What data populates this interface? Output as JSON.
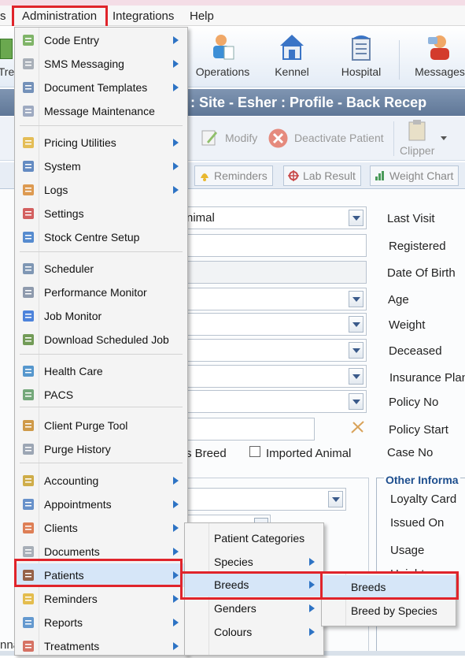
{
  "menubar": {
    "items": [
      "s",
      "Administration",
      "Integrations",
      "Help"
    ]
  },
  "toolbar": {
    "left_partial": "Tre",
    "buttons": [
      "Operations",
      "Kennel",
      "Hospital",
      "Messages"
    ]
  },
  "title": ": Site - Esher : Profile - Back Recep",
  "actions": {
    "modify": "Modify",
    "deactivate": "Deactivate Patient",
    "clipper": "Clipper"
  },
  "tabs": [
    "Reminders",
    "Lab Result",
    "Weight Chart"
  ],
  "form": {
    "animal_value": "nimal",
    "breed_partial": "s Breed",
    "imported_label": "Imported Animal",
    "labels": [
      "Last Visit",
      "Registered",
      "Date Of Birth",
      "Age",
      "Weight",
      "Deceased",
      "Insurance Plan",
      "Policy No",
      "Policy Start",
      "Case No"
    ],
    "other_info_title": "Other Informa",
    "other_labels": [
      "Loyalty Card",
      "Issued On",
      "Usage",
      "Height"
    ],
    "bottom_partial": "nna"
  },
  "admin_menu": {
    "items": [
      {
        "label": "Code Entry",
        "icon": "code-entry-icon",
        "submenu": true
      },
      {
        "label": "SMS Messaging",
        "icon": "sms-icon",
        "submenu": true
      },
      {
        "label": "Document Templates",
        "icon": "document-templates-icon",
        "submenu": true
      },
      {
        "label": "Message Maintenance",
        "icon": "message-maintenance-icon",
        "submenu": false
      },
      {
        "label": "Pricing Utilities",
        "icon": "pricing-icon",
        "submenu": true
      },
      {
        "label": "System",
        "icon": "system-icon",
        "submenu": true
      },
      {
        "label": "Logs",
        "icon": "logs-icon",
        "submenu": true
      },
      {
        "label": "Settings",
        "icon": "settings-icon",
        "submenu": false
      },
      {
        "label": "Stock Centre Setup",
        "icon": "stock-icon",
        "submenu": false
      },
      {
        "label": "Scheduler",
        "icon": "scheduler-icon",
        "submenu": false
      },
      {
        "label": "Performance Monitor",
        "icon": "performance-icon",
        "submenu": false
      },
      {
        "label": "Job Monitor",
        "icon": "job-monitor-icon",
        "submenu": false
      },
      {
        "label": "Download Scheduled Job",
        "icon": "download-job-icon",
        "submenu": false
      },
      {
        "label": "Health Care",
        "icon": "health-care-icon",
        "submenu": false
      },
      {
        "label": "PACS",
        "icon": "pacs-icon",
        "submenu": false
      },
      {
        "label": "Client Purge Tool",
        "icon": "purge-tool-icon",
        "submenu": false
      },
      {
        "label": "Purge History",
        "icon": "purge-history-icon",
        "submenu": false
      },
      {
        "label": "Accounting",
        "icon": "accounting-icon",
        "submenu": true
      },
      {
        "label": "Appointments",
        "icon": "appointments-icon",
        "submenu": true
      },
      {
        "label": "Clients",
        "icon": "clients-icon",
        "submenu": true
      },
      {
        "label": "Documents",
        "icon": "documents-icon",
        "submenu": true
      },
      {
        "label": "Patients",
        "icon": "patients-icon",
        "submenu": true
      },
      {
        "label": "Reminders",
        "icon": "reminders-icon",
        "submenu": true
      },
      {
        "label": "Reports",
        "icon": "reports-icon",
        "submenu": true
      },
      {
        "label": "Treatments",
        "icon": "treatments-icon",
        "submenu": true
      }
    ]
  },
  "patients_menu": {
    "items": [
      {
        "label": "Patient Categories",
        "submenu": false
      },
      {
        "label": "Species",
        "submenu": true
      },
      {
        "label": "Breeds",
        "submenu": true
      },
      {
        "label": "Genders",
        "submenu": true
      },
      {
        "label": "Colours",
        "submenu": true
      }
    ]
  },
  "breeds_menu": {
    "items": [
      {
        "label": "Breeds"
      },
      {
        "label": "Breed by Species"
      }
    ]
  },
  "colors": {
    "highlight_red": "#e0242b",
    "title_bar": "#6c84a4",
    "menu_hover": "#d6e6f8"
  }
}
